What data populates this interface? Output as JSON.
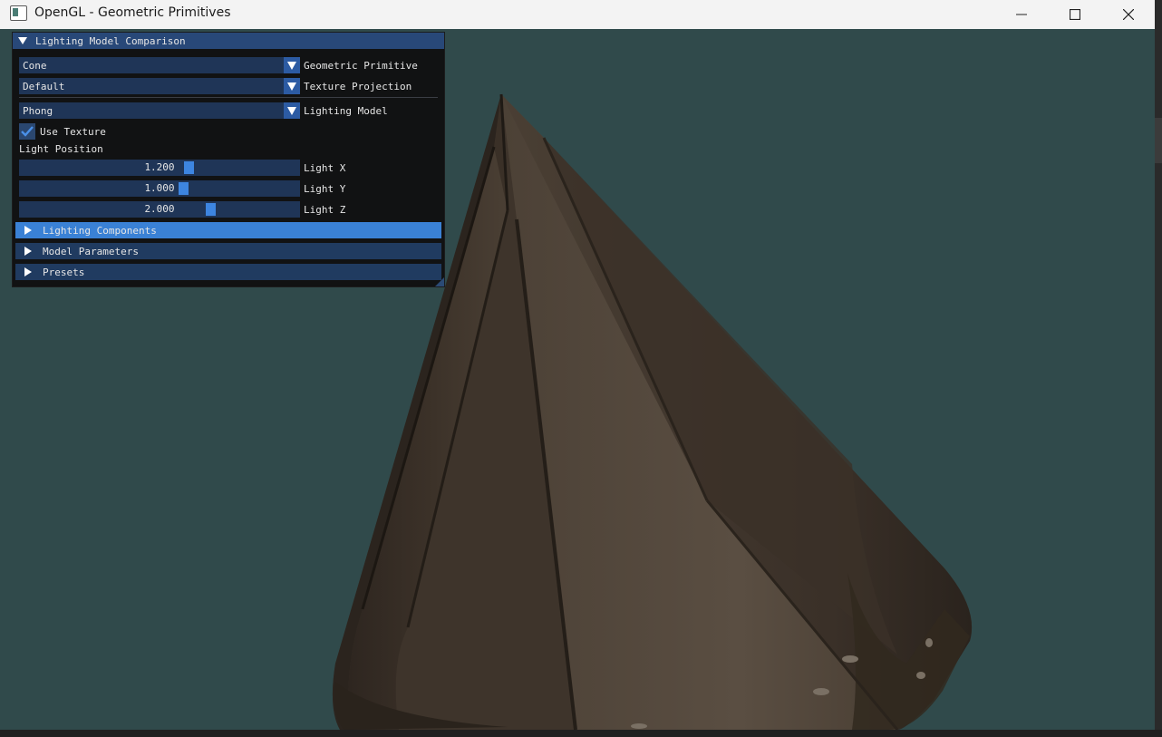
{
  "window": {
    "title": "OpenGL - Geometric Primitives",
    "bg_color": "#304a4b"
  },
  "panel": {
    "title": "Lighting Model Comparison",
    "primitive": {
      "value": "Cone",
      "label": "Geometric Primitive"
    },
    "projection": {
      "value": "Default",
      "label": "Texture Projection"
    },
    "lighting": {
      "value": "Phong",
      "label": "Lighting Model"
    },
    "use_texture": {
      "label": "Use Texture",
      "checked": true
    },
    "light_position_label": "Light Position",
    "light_x": {
      "value": "1.200",
      "label": "Light X",
      "fraction": 0.61
    },
    "light_y": {
      "value": "1.000",
      "label": "Light Y",
      "fraction": 0.59
    },
    "light_z": {
      "value": "2.000",
      "label": "Light Z",
      "fraction": 0.69
    },
    "sections": [
      {
        "label": "Lighting Components",
        "active": true
      },
      {
        "label": "Model Parameters",
        "active": false
      },
      {
        "label": "Presets",
        "active": false
      }
    ]
  }
}
